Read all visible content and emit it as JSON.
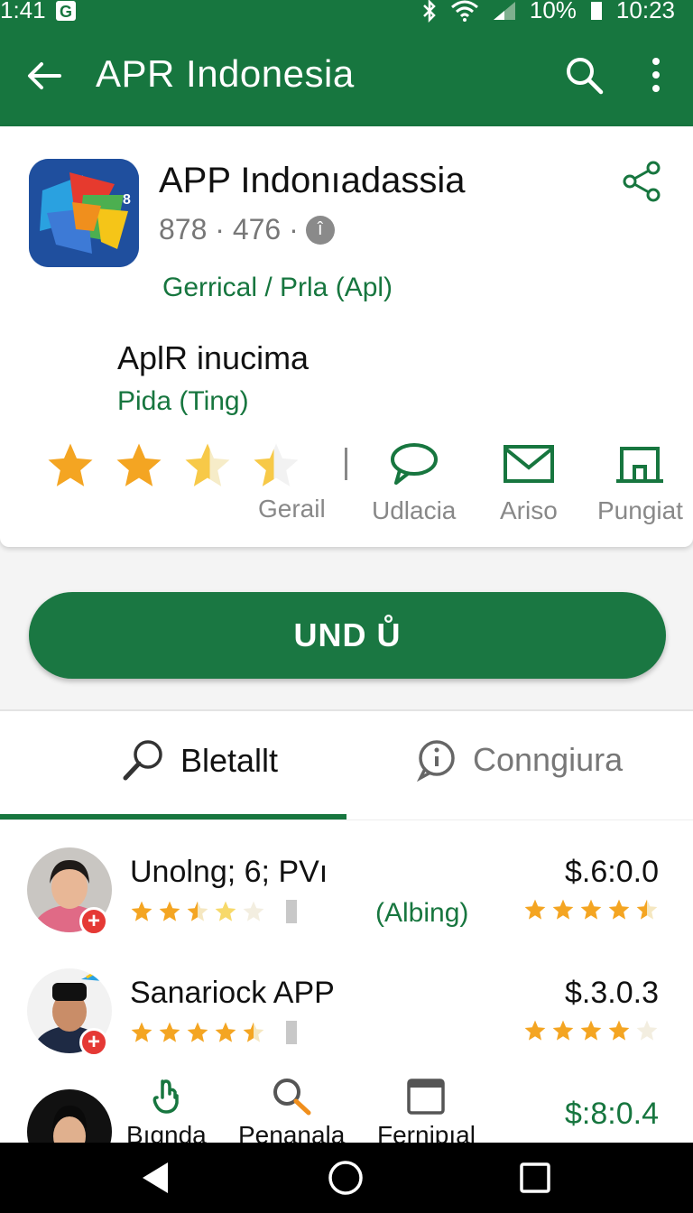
{
  "status_bar": {
    "time": "1:41",
    "battery": "10%",
    "clock_right": "10:23",
    "icons": [
      "g-notification-icon",
      "bluetooth-icon",
      "wifi-icon",
      "signal-icon",
      "battery-icon"
    ]
  },
  "app_bar": {
    "title": "APR Indonesia",
    "icons": [
      "back-arrow-icon",
      "search-icon",
      "more-vert-icon"
    ]
  },
  "app_info": {
    "name": "APP Indonıadassia",
    "meta": "878 · 476 ·",
    "meta_badge": "î",
    "category": "Gerrical / Prla (Apl)",
    "sub_title": "AplR inucima",
    "sub_price": "Pida (Ting)",
    "rating": 3.4
  },
  "actions": {
    "gerail": "Gerail",
    "udlacia": "Udlacia",
    "ariso": "Ariso",
    "pungiat": "Pungiat"
  },
  "install_button": "UND Ů",
  "tabs": {
    "tab1": "Bletallt",
    "tab2": "Conngiura"
  },
  "list": [
    {
      "name": "Unolng; 6; PVı",
      "price": "$.6:0.0",
      "tag": "(Albing)",
      "rating_left": 2.5,
      "rating_right": 4.5
    },
    {
      "name": "Sanariock APP",
      "price": "$.3.0.3",
      "tag": "",
      "rating_left": 4.5,
      "rating_right": 4.0
    },
    {
      "name": "",
      "price": "$:8:0.4",
      "tag": "",
      "rating_left": 0,
      "rating_right": 0
    }
  ],
  "bottom_items": {
    "item1": "Bıgnda",
    "item2": "Penanala",
    "item3": "Fernipıal"
  },
  "colors": {
    "primary_green": "#17763f",
    "star_gold": "#f4a522",
    "badge_red": "#e53935"
  }
}
